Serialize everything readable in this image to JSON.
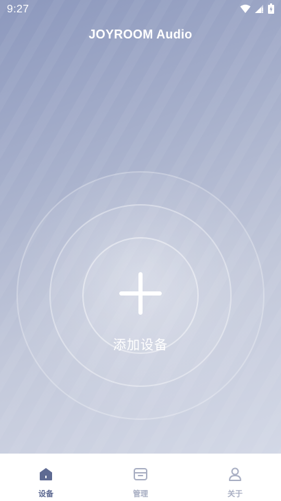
{
  "status_bar": {
    "time": "9:27",
    "icons": [
      "wifi-icon",
      "cellular-signal-icon",
      "battery-icon"
    ]
  },
  "header": {
    "title": "JOYROOM Audio"
  },
  "main": {
    "add_device_label": "添加设备",
    "add_icon": "plus-icon"
  },
  "tab_bar": {
    "tabs": [
      {
        "label": "设备",
        "icon": "home-icon",
        "active": true
      },
      {
        "label": "管理",
        "icon": "box-icon",
        "active": false
      },
      {
        "label": "关于",
        "icon": "user-icon",
        "active": false
      }
    ]
  },
  "colors": {
    "tab_active": "#5e6a92",
    "tab_inactive": "#a9afc3",
    "background_top": "#8c98bd",
    "background_bottom": "#d3d8e6"
  }
}
